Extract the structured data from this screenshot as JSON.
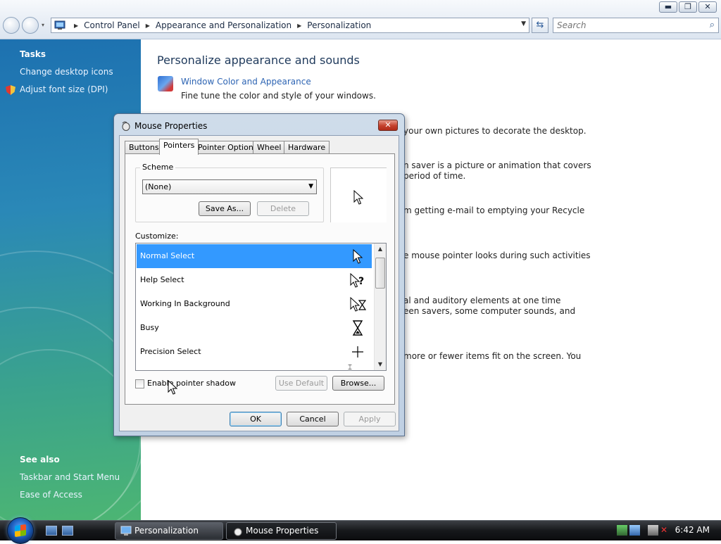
{
  "window": {
    "controls": [
      "minimize",
      "restore",
      "close"
    ]
  },
  "address": {
    "crumbs": [
      "Control Panel",
      "Appearance and Personalization",
      "Personalization"
    ],
    "search_placeholder": "Search"
  },
  "left_pane": {
    "tasks_heading": "Tasks",
    "tasks": [
      "Change desktop icons",
      "Adjust font size (DPI)"
    ],
    "see_also_heading": "See also",
    "see_also": [
      "Taskbar and Start Menu",
      "Ease of Access"
    ]
  },
  "main": {
    "title": "Personalize appearance and sounds",
    "first_item": {
      "link": "Window Color and Appearance",
      "desc": "Fine tune the color and style of your windows."
    },
    "peek_texts": [
      "your own pictures to decorate the desktop.",
      "n saver is a picture or animation that covers",
      "period of time.",
      "m getting e-mail to emptying your Recycle",
      "e mouse pointer looks during such activities",
      "al and auditory elements at one time",
      "een savers, some computer sounds, and",
      "more or fewer items fit on the screen. You"
    ]
  },
  "dialog": {
    "title": "Mouse Properties",
    "tabs": [
      "Buttons",
      "Pointers",
      "Pointer Options",
      "Wheel",
      "Hardware"
    ],
    "active_tab": "Pointers",
    "scheme_label": "Scheme",
    "scheme_value": "(None)",
    "save_as": "Save As...",
    "delete": "Delete",
    "customize_label": "Customize:",
    "pointers": [
      {
        "name": "Normal Select",
        "icon": "arrow-cursor-icon",
        "selected": true
      },
      {
        "name": "Help Select",
        "icon": "help-cursor-icon",
        "selected": false
      },
      {
        "name": "Working In Background",
        "icon": "working-cursor-icon",
        "selected": false
      },
      {
        "name": "Busy",
        "icon": "hourglass-cursor-icon",
        "selected": false
      },
      {
        "name": "Precision Select",
        "icon": "crosshair-cursor-icon",
        "selected": false
      }
    ],
    "shadow_label": "Enable pointer shadow",
    "shadow_checked": false,
    "use_default": "Use Default",
    "browse": "Browse...",
    "ok": "OK",
    "cancel": "Cancel",
    "apply": "Apply"
  },
  "taskbar": {
    "tasks": [
      "Personalization",
      "Mouse Properties"
    ],
    "active_task": "Mouse Properties",
    "clock": "6:42 AM"
  },
  "colors": {
    "link": "#2d64b3",
    "selection": "#3399ff",
    "pane_top": "#1d71b0",
    "pane_bottom": "#4cb573"
  }
}
